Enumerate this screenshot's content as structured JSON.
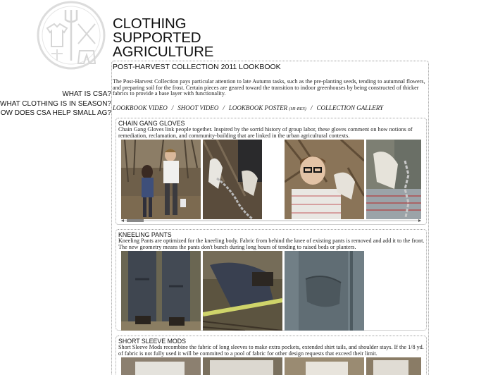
{
  "site": {
    "title_lines": [
      "CLOTHING",
      "SUPPORTED",
      "AGRICULTURE"
    ]
  },
  "sidenav": {
    "items": [
      "WHAT IS CSA?",
      "WHAT CLOTHING IS IN SEASON?",
      "HOW DOES CSA HELP SMALL AG?"
    ]
  },
  "collection": {
    "title": "POST-HARVEST COLLECTION 2011 LOOKBOOK",
    "intro": "The Post-Harvest Collection pays particular attention to late Autumn tasks, such as the pre-planting seeds, tending to autumnal flowers, and preparing soil for the frost. Certain pieces are geared toward the transition to indoor greenhouses by being constructed of thicker fabrics to provide a base layer with functionality.",
    "links": {
      "lookbook_video": "LOOKBOOK VIDEO",
      "shoot_video": "SHOOT VIDEO",
      "lookbook_poster": "LOOKBOOK POSTER",
      "hi_res": "(HI-RES)",
      "collection_gallery": "COLLECTION GALLERY",
      "separator": "/"
    }
  },
  "sections": [
    {
      "title": "CHAIN GANG GLOVES",
      "description": "Chain Gang Gloves link people together. Inspired by the sorrid history of group labor, these gloves comment on how notions of remediation, reclamation, and community-building that are linked in the urban agricultural contexts."
    },
    {
      "title": "KNEELING PANTS",
      "description": "Kneeling Pants are optimized for the kneeling body. Fabric from behind the knee of existing pants is removed and add it to the front. The new geometry means the pants don't bunch during long hours of tending to raised beds or planters."
    },
    {
      "title": "SHORT SLEEVE MODS",
      "description": "Short Sleeve Mods recombine the fabric of long sleeves to make extra pockets, extended shirt tails, and shoulder stays. If the 1/8 yd. of fabric is not fully used it will be commited to a pool of fabric for other design requests that exceed their limit."
    }
  ],
  "colors": {
    "text": "#111111",
    "border": "#9a9a9a",
    "logo": "#d9d9d9"
  }
}
